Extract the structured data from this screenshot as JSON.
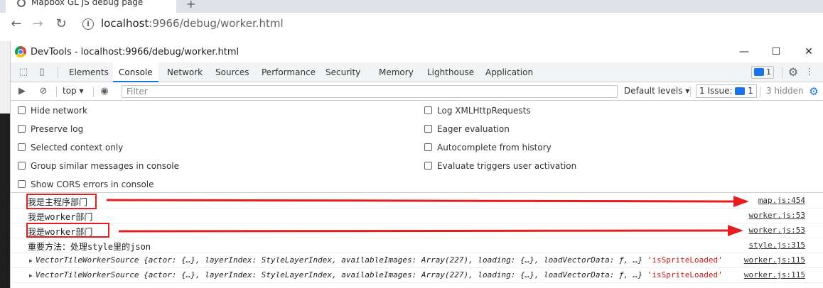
{
  "browser": {
    "tab_title": "Mapbox GL JS debug page",
    "new_tab": "+",
    "back": "←",
    "forward": "→",
    "reload": "↻",
    "url_host": "localhost",
    "url_rest": ":9966/debug/worker.html"
  },
  "devtools": {
    "title": "DevTools - localhost:9966/debug/worker.html",
    "window_buttons": {
      "minimize": "—",
      "maximize": "☐",
      "close": "✕"
    },
    "tabs": [
      {
        "label": "Elements",
        "active": false
      },
      {
        "label": "Console",
        "active": true
      },
      {
        "label": "Network",
        "active": false
      },
      {
        "label": "Sources",
        "active": false
      },
      {
        "label": "Performance",
        "active": false
      },
      {
        "label": "Security",
        "active": false
      },
      {
        "label": "Memory",
        "active": false
      },
      {
        "label": "Lighthouse",
        "active": false
      },
      {
        "label": "Application",
        "active": false
      }
    ],
    "message_badge_count": "1",
    "settings_icon": "⚙",
    "more_icon": "⋮",
    "close_icon": "✕"
  },
  "filter_bar": {
    "context": "top",
    "filter_placeholder": "Filter",
    "levels": "Default levels",
    "issues_label": "1 Issue:",
    "issues_count": "1",
    "hidden": "3 hidden"
  },
  "settings": {
    "left": [
      "Hide network",
      "Preserve log",
      "Selected context only",
      "Group similar messages in console",
      "Show CORS errors in console"
    ],
    "right": [
      "Log XMLHttpRequests",
      "Eager evaluation",
      "Autocomplete from history",
      "Evaluate triggers user activation"
    ]
  },
  "console": {
    "rows": [
      {
        "text": "我是主程序部门",
        "source": "map.js:454"
      },
      {
        "text": "我是worker部门",
        "source": "worker.js:53"
      },
      {
        "text": "我是worker部门",
        "source": "worker.js:53"
      },
      {
        "text": "重要方法：处理style里的json",
        "source": "style.js:315"
      },
      {
        "text": "VectorTileWorkerSource {actor: {…}, layerIndex: StyleLayerIndex, availableImages: Array(227), loading: {…}, loadVectorData: ƒ, …}",
        "string": "'isSpriteLoaded'",
        "source": "worker.js:115"
      },
      {
        "text": "VectorTileWorkerSource {actor: {…}, layerIndex: StyleLayerIndex, availableImages: Array(227), loading: {…}, loadVectorData: ƒ, …}",
        "string": "'isSpriteLoaded'",
        "source": "worker.js:115"
      }
    ]
  },
  "colors": {
    "accent": "#1a73e8",
    "annotation_red": "#e41e1e"
  }
}
